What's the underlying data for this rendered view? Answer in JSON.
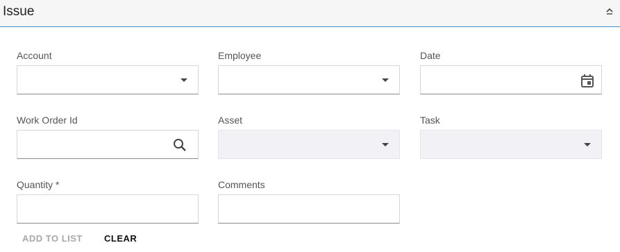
{
  "header": {
    "title": "Issue",
    "collapse_icon": "chevron-up-icon"
  },
  "fields": {
    "account": {
      "label": "Account",
      "value": "",
      "icon": "dropdown-caret-icon"
    },
    "employee": {
      "label": "Employee",
      "value": "",
      "icon": "dropdown-caret-icon"
    },
    "date": {
      "label": "Date",
      "value": "",
      "icon": "calendar-icon"
    },
    "work_order_id": {
      "label": "Work Order Id",
      "value": "",
      "icon": "search-icon"
    },
    "asset": {
      "label": "Asset",
      "value": "",
      "icon": "dropdown-caret-icon"
    },
    "task": {
      "label": "Task",
      "value": "",
      "icon": "dropdown-caret-icon"
    },
    "quantity": {
      "label": "Quantity *",
      "value": ""
    },
    "comments": {
      "label": "Comments",
      "value": ""
    }
  },
  "actions": {
    "add_to_list": "ADD TO LIST",
    "clear": "CLEAR"
  },
  "colors": {
    "accent_border": "#3f8fcf",
    "disabled_field": "#f1f1f6"
  }
}
